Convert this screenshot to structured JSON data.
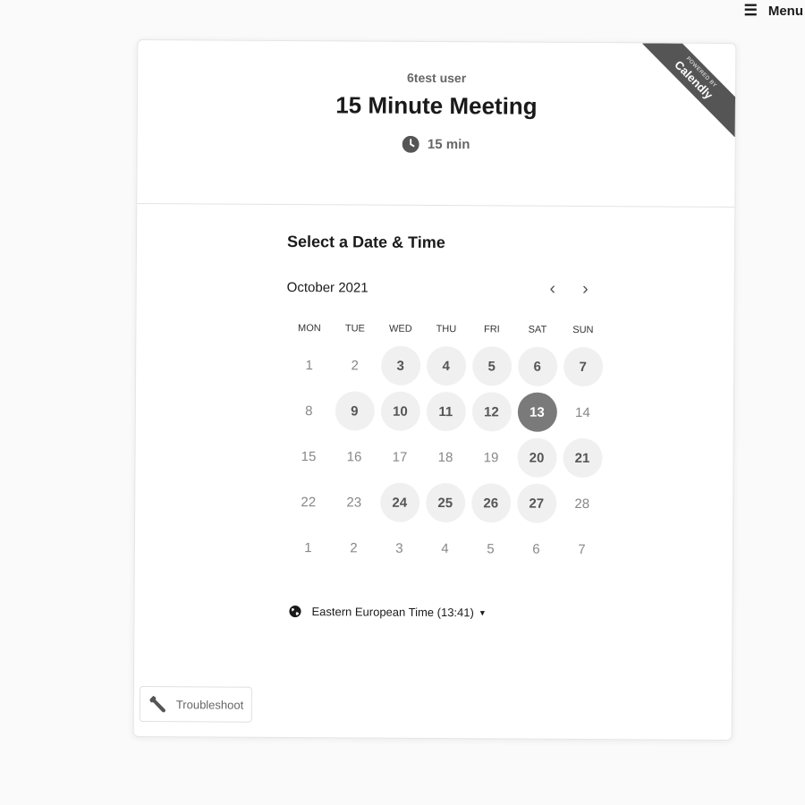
{
  "menu": {
    "icon": "hamburger-icon",
    "label": "Menu"
  },
  "ribbon": {
    "small_text": "POWERED BY",
    "brand": "Calendly",
    "color": "#555555"
  },
  "event": {
    "host": "6test user",
    "title": "15 Minute Meeting",
    "duration_icon": "clock-icon",
    "duration": "15 min"
  },
  "picker": {
    "title": "Select a Date & Time",
    "month": "October 2021",
    "prev_icon": "chevron-left-icon",
    "next_icon": "chevron-right-icon",
    "prev_glyph": "‹",
    "next_glyph": "›",
    "weekdays": [
      "MON",
      "TUE",
      "WED",
      "THU",
      "FRI",
      "SAT",
      "SUN"
    ],
    "days": [
      {
        "label": "1",
        "state": "unavailable"
      },
      {
        "label": "2",
        "state": "unavailable"
      },
      {
        "label": "3",
        "state": "available"
      },
      {
        "label": "4",
        "state": "available"
      },
      {
        "label": "5",
        "state": "available"
      },
      {
        "label": "6",
        "state": "available"
      },
      {
        "label": "7",
        "state": "available"
      },
      {
        "label": "8",
        "state": "unavailable"
      },
      {
        "label": "9",
        "state": "available"
      },
      {
        "label": "10",
        "state": "available"
      },
      {
        "label": "11",
        "state": "available"
      },
      {
        "label": "12",
        "state": "available"
      },
      {
        "label": "13",
        "state": "selected"
      },
      {
        "label": "14",
        "state": "unavailable"
      },
      {
        "label": "15",
        "state": "unavailable"
      },
      {
        "label": "16",
        "state": "unavailable"
      },
      {
        "label": "17",
        "state": "unavailable"
      },
      {
        "label": "18",
        "state": "unavailable"
      },
      {
        "label": "19",
        "state": "unavailable"
      },
      {
        "label": "20",
        "state": "available"
      },
      {
        "label": "21",
        "state": "available"
      },
      {
        "label": "22",
        "state": "unavailable"
      },
      {
        "label": "23",
        "state": "unavailable"
      },
      {
        "label": "24",
        "state": "available"
      },
      {
        "label": "25",
        "state": "available"
      },
      {
        "label": "26",
        "state": "available"
      },
      {
        "label": "27",
        "state": "available"
      },
      {
        "label": "28",
        "state": "unavailable"
      },
      {
        "label": "1",
        "state": "unavailable"
      },
      {
        "label": "2",
        "state": "unavailable"
      },
      {
        "label": "3",
        "state": "unavailable"
      },
      {
        "label": "4",
        "state": "unavailable"
      },
      {
        "label": "5",
        "state": "unavailable"
      },
      {
        "label": "6",
        "state": "unavailable"
      },
      {
        "label": "7",
        "state": "unavailable"
      }
    ],
    "timezone_icon": "globe-icon",
    "timezone": "Eastern European Time (13:41)",
    "timezone_caret": "▼"
  },
  "troubleshoot": {
    "icon": "wrench-icon",
    "label": "Troubleshoot"
  },
  "colors": {
    "available_bg": "#f0f0f0",
    "selected_bg": "#7a7a7a",
    "text_dark": "#1a1a1a",
    "text_muted": "#666666"
  }
}
